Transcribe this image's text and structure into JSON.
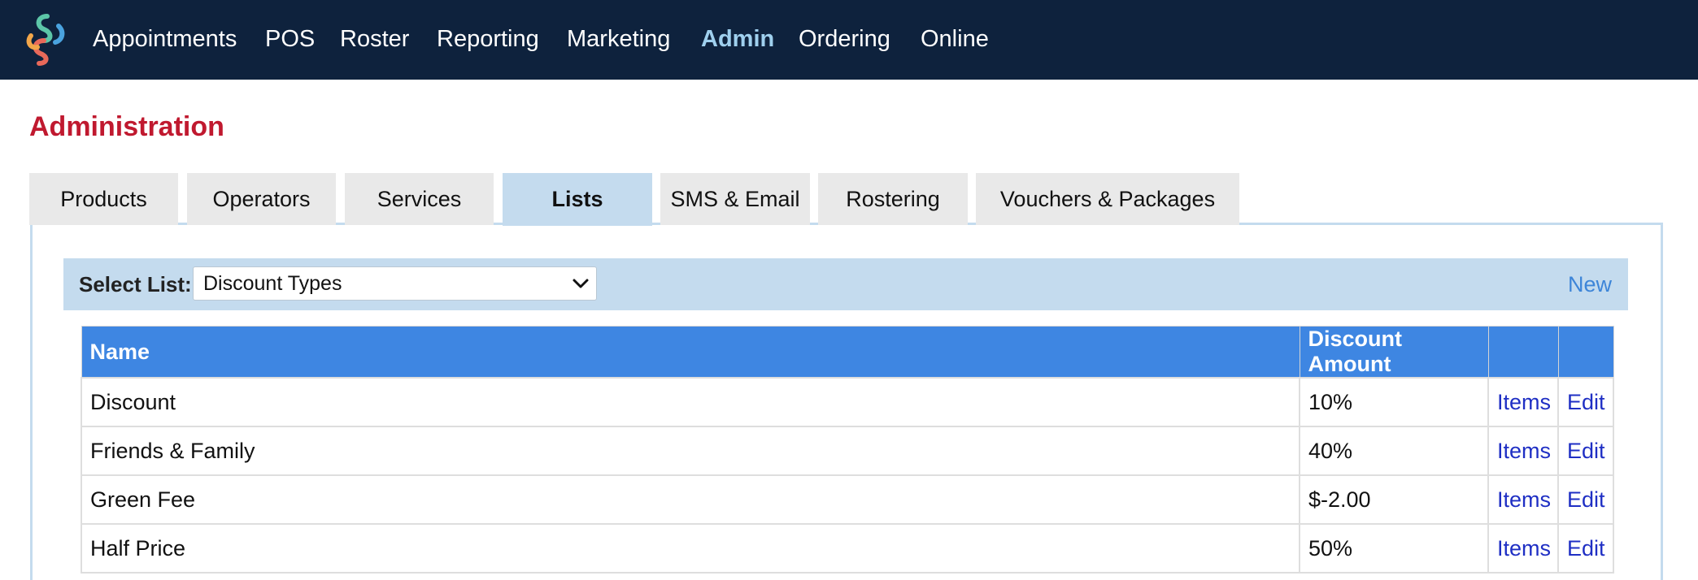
{
  "nav": {
    "items": [
      {
        "label": "Appointments",
        "active": false
      },
      {
        "label": "POS",
        "active": false
      },
      {
        "label": "Roster",
        "active": false
      },
      {
        "label": "Reporting",
        "active": false
      },
      {
        "label": "Marketing",
        "active": false
      },
      {
        "label": "Admin",
        "active": true
      },
      {
        "label": "Ordering",
        "active": false
      },
      {
        "label": "Online",
        "active": false
      }
    ],
    "logo_icon": "app-logo-icon"
  },
  "page": {
    "title": "Administration"
  },
  "tabs": [
    {
      "label": "Products",
      "active": false
    },
    {
      "label": "Operators",
      "active": false
    },
    {
      "label": "Services",
      "active": false
    },
    {
      "label": "Lists",
      "active": true
    },
    {
      "label": "SMS & Email",
      "active": false
    },
    {
      "label": "Rostering",
      "active": false
    },
    {
      "label": "Vouchers & Packages",
      "active": false
    }
  ],
  "toolbar": {
    "select_label": "Select List:",
    "select_value": "Discount Types",
    "new_label": "New"
  },
  "table": {
    "columns": [
      "Name",
      "Discount Amount",
      "",
      ""
    ],
    "rows": [
      {
        "name": "Discount",
        "amount": "10%",
        "items": "Items",
        "edit": "Edit"
      },
      {
        "name": "Friends & Family",
        "amount": "40%",
        "items": "Items",
        "edit": "Edit"
      },
      {
        "name": "Green Fee",
        "amount": "$-2.00",
        "items": "Items",
        "edit": "Edit"
      },
      {
        "name": "Half Price",
        "amount": "50%",
        "items": "Items",
        "edit": "Edit"
      }
    ]
  },
  "colors": {
    "nav_bg": "#0e223d",
    "nav_active": "#9fd0ee",
    "title_red": "#c0192f",
    "tab_active_bg": "#c4dbee",
    "table_header_bg": "#3e86e2",
    "link_blue": "#1f2fc4"
  }
}
